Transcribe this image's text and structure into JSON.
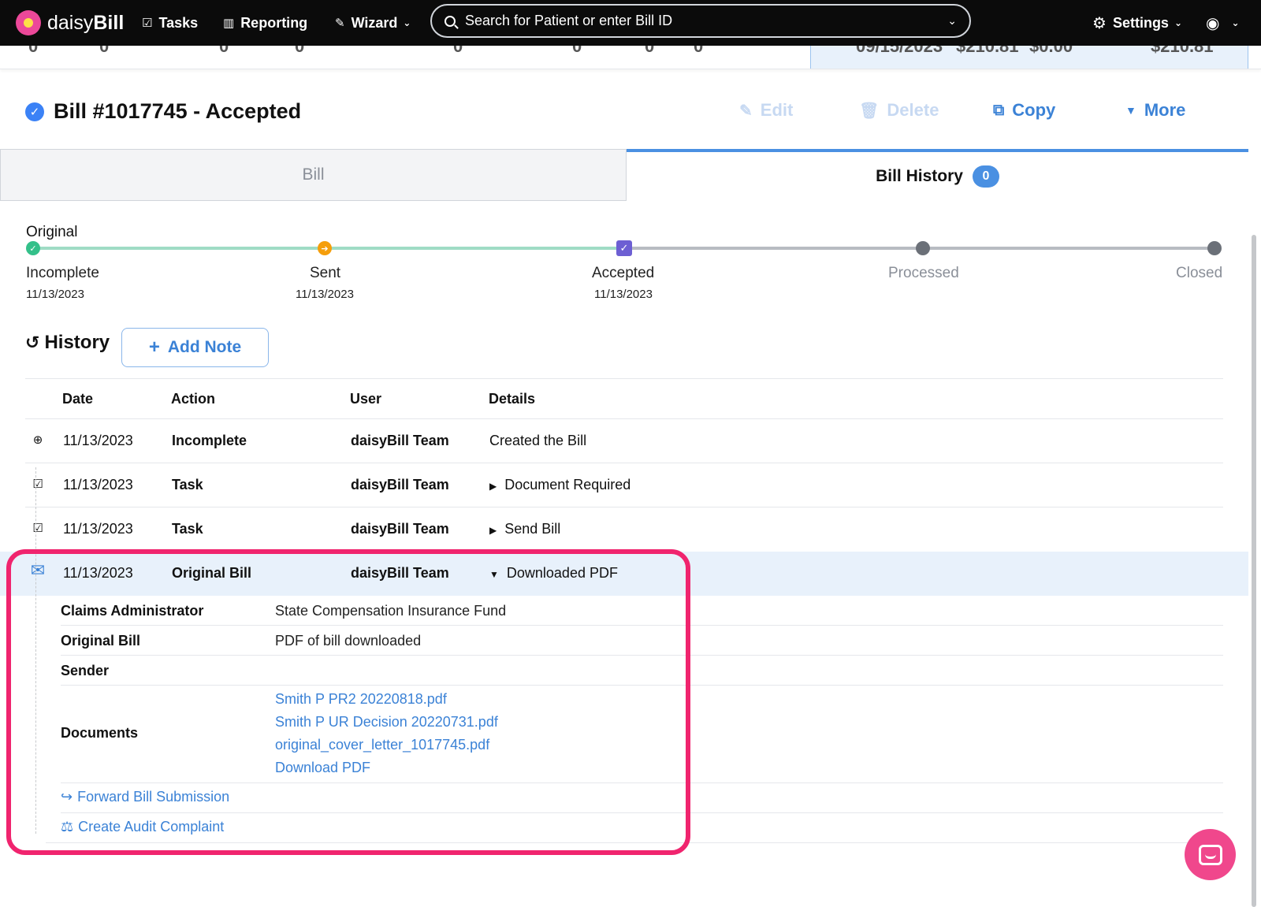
{
  "nav": {
    "logo_light": "daisy",
    "logo_bold": "Bill",
    "tasks": "Tasks",
    "reporting": "Reporting",
    "wizard": "Wizard",
    "search_placeholder": "Search for Patient or enter Bill ID",
    "settings": "Settings"
  },
  "summary_strip": [
    "0",
    "0",
    "0",
    "0",
    "0",
    "0",
    "0",
    "0",
    "09/15/2023",
    "$210.81",
    "$0.00",
    "$210.81"
  ],
  "bill": {
    "title": "Bill #1017745 - Accepted",
    "actions": {
      "edit": "Edit",
      "delete": "Delete",
      "copy": "Copy",
      "more": "More"
    }
  },
  "tabs": {
    "bill": "Bill",
    "history": "Bill History",
    "history_count": "0"
  },
  "progress": {
    "label": "Original",
    "steps": [
      {
        "name": "Incomplete",
        "date": "11/13/2023",
        "state": "done"
      },
      {
        "name": "Sent",
        "date": "11/13/2023",
        "state": "done"
      },
      {
        "name": "Accepted",
        "date": "11/13/2023",
        "state": "current"
      },
      {
        "name": "Processed",
        "date": "",
        "state": "future"
      },
      {
        "name": "Closed",
        "date": "",
        "state": "future"
      }
    ]
  },
  "history": {
    "title": "History",
    "add_note": "Add Note",
    "columns": [
      "Date",
      "Action",
      "User",
      "Details"
    ],
    "rows": [
      {
        "icon": "plus-circle-icon",
        "date": "11/13/2023",
        "action": "Incomplete",
        "user": "daisyBill Team",
        "details": "Created the Bill"
      },
      {
        "icon": "clipboard-check-icon",
        "date": "11/13/2023",
        "action": "Task",
        "user": "daisyBill Team",
        "details": "Document Required"
      },
      {
        "icon": "clipboard-check-icon",
        "date": "11/13/2023",
        "action": "Task",
        "user": "daisyBill Team",
        "details": "Send Bill"
      },
      {
        "icon": "envelope-icon",
        "date": "11/13/2023",
        "action": "Original Bill",
        "user": "daisyBill Team",
        "details": "Downloaded PDF"
      }
    ],
    "expanded": {
      "claims_admin_label": "Claims Administrator",
      "claims_admin_value": "State Compensation Insurance Fund",
      "original_bill_label": "Original Bill",
      "original_bill_value": "PDF of bill downloaded",
      "sender_label": "Sender",
      "documents_label": "Documents",
      "documents": [
        "Smith P PR2 20220818.pdf",
        "Smith P UR Decision 20220731.pdf",
        "original_cover_letter_1017745.pdf",
        "Download PDF"
      ],
      "forward_link": "Forward Bill Submission",
      "audit_link": "Create Audit Complaint"
    }
  },
  "colors": {
    "accent": "#3b82d6",
    "highlight": "#f0246e",
    "chat": "#f0478c",
    "progress_done": "#9fdcc5",
    "progress_todo": "#b8bcc2"
  }
}
